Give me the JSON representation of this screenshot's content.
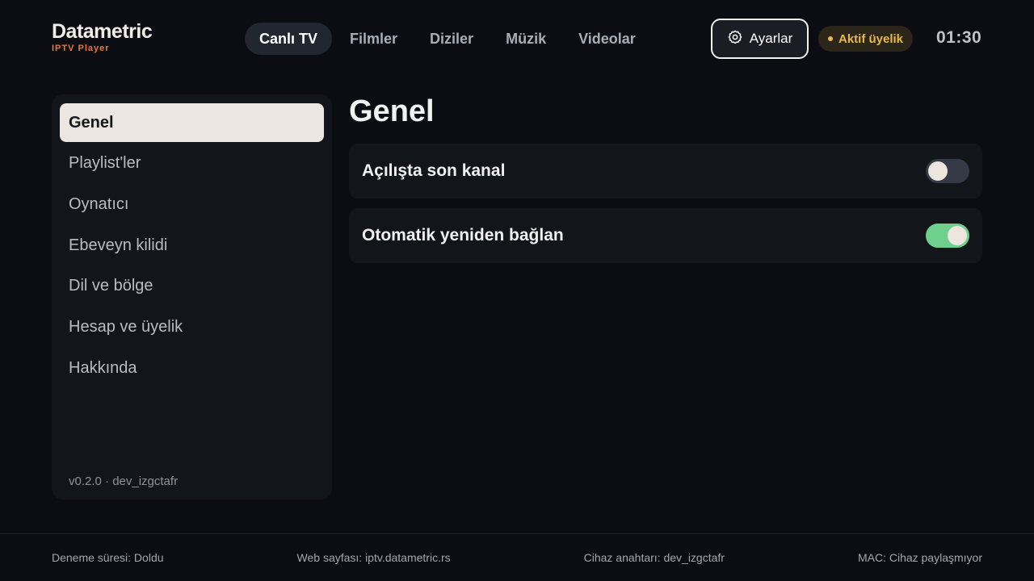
{
  "app": {
    "title": "Datametric",
    "subtitle": "IPTV Player"
  },
  "nav": {
    "items": [
      {
        "label": "Canlı TV",
        "active": true
      },
      {
        "label": "Filmler",
        "active": false
      },
      {
        "label": "Diziler",
        "active": false
      },
      {
        "label": "Müzik",
        "active": false
      },
      {
        "label": "Videolar",
        "active": false
      }
    ]
  },
  "header": {
    "settings_label": "Ayarlar",
    "settings_icon": "gear-icon",
    "membership_label": "Aktif üyelik",
    "clock": "01:30"
  },
  "sidebar": {
    "items": [
      {
        "label": "Genel",
        "active": true
      },
      {
        "label": "Playlist'ler",
        "active": false
      },
      {
        "label": "Oynatıcı",
        "active": false
      },
      {
        "label": "Ebeveyn kilidi",
        "active": false
      },
      {
        "label": "Dil ve bölge",
        "active": false
      },
      {
        "label": "Hesap ve üyelik",
        "active": false
      },
      {
        "label": "Hakkında",
        "active": false
      }
    ],
    "version": "v0.2.0 · dev_izgctafr"
  },
  "main": {
    "title": "Genel",
    "settings": [
      {
        "label": "Açılışta son kanal",
        "enabled": false
      },
      {
        "label": "Otomatik yeniden bağlan",
        "enabled": true
      }
    ]
  },
  "footer": {
    "trial": "Deneme süresi: Doldu",
    "website": "Web sayfası: iptv.datametric.rs",
    "device_key": "Cihaz anahtarı: dev_izgctafr",
    "mac": "MAC: Cihaz paylaşmıyor"
  },
  "colors": {
    "background": "#0b0d12",
    "accent_orange": "#e07a3c",
    "badge_gold": "#e9b949",
    "toggle_on": "#6fcf8d",
    "toggle_off": "#363a47"
  }
}
